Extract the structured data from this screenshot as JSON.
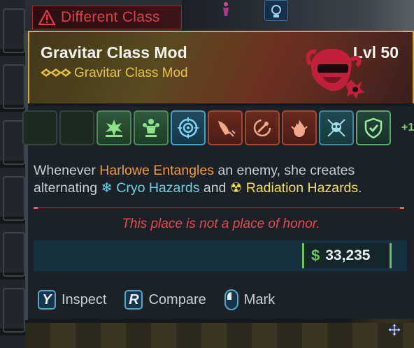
{
  "warning": {
    "label": "Different Class",
    "icon": "warning-triangle-icon"
  },
  "item": {
    "title": "Gravitar Class Mod",
    "level": "Lvl 50",
    "subtitle": "Gravitar Class Mod",
    "rarity_icon": "legendary-chevrons-icon",
    "portrait_icon": "harlowe-portrait-icon"
  },
  "perks": {
    "slots": [
      {
        "name": "empty-slot-1",
        "style": "empty",
        "icon": "empty-slot"
      },
      {
        "name": "empty-slot-2",
        "style": "empty",
        "icon": "empty-slot"
      },
      {
        "name": "perk-slot-3",
        "style": "green",
        "icon": "burst-icon"
      },
      {
        "name": "perk-slot-4",
        "style": "green",
        "icon": "figure-skill-icon"
      },
      {
        "name": "perk-slot-5",
        "style": "blue",
        "icon": "crosshair-icon"
      },
      {
        "name": "perk-slot-6",
        "style": "orange",
        "icon": "wing-icon"
      },
      {
        "name": "perk-slot-7",
        "style": "orange",
        "icon": "orbit-icon"
      },
      {
        "name": "perk-slot-8",
        "style": "orange",
        "icon": "flame-icon"
      },
      {
        "name": "perk-slot-9",
        "style": "teal",
        "icon": "skull-crossed-icon"
      },
      {
        "name": "perk-slot-10",
        "style": "lgreen",
        "icon": "shield-icon"
      }
    ],
    "more_label": "+1"
  },
  "description": {
    "p1": "Whenever ",
    "name": "Harlowe Entangles",
    "p2": " an enemy, she creates alternating ",
    "cryo_icon": "snowflake-icon",
    "cryo": "Cryo Hazards",
    "p3": " and ",
    "rad_icon": "radiation-icon",
    "rad": "Radiation Hazards",
    "p4": "."
  },
  "flavor": "This place is not a place of honor.",
  "price": {
    "symbol": "$",
    "amount": "33,235"
  },
  "actions": [
    {
      "key": "Y",
      "label": "Inspect"
    },
    {
      "key": "R",
      "label": "Compare"
    },
    {
      "key_icon": "mouse-icon",
      "label": "Mark"
    }
  ],
  "colors": {
    "accent_gold": "#c9a440",
    "warning_red": "#e53a48",
    "legendary_text": "#e6c24a",
    "price_green": "#6cc45a"
  }
}
